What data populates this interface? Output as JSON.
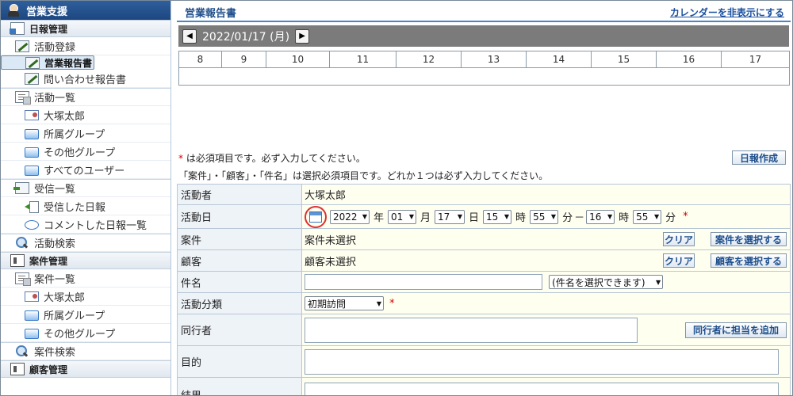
{
  "sidebar": {
    "header": "営業支援",
    "sections": [
      {
        "title": "日報管理",
        "items": [
          {
            "label": "活動登録",
            "icon": "pencil-icon"
          },
          {
            "label": "営業報告書",
            "icon": "pencil-icon",
            "selected": true
          },
          {
            "label": "問い合わせ報告書",
            "icon": "pencil-icon"
          },
          {
            "label": "活動一覧",
            "icon": "list-icon"
          },
          {
            "label": "大塚太郎",
            "icon": "user-card-icon"
          },
          {
            "label": "所属グループ",
            "icon": "folder-icon"
          },
          {
            "label": "その他グループ",
            "icon": "folder-icon"
          },
          {
            "label": "すべてのユーザー",
            "icon": "folder-icon"
          },
          {
            "label": "受信一覧",
            "icon": "inbox-icon"
          },
          {
            "label": "受信した日報",
            "icon": "arrow-in-icon"
          },
          {
            "label": "コメントした日報一覧",
            "icon": "comment-icon"
          },
          {
            "label": "活動検索",
            "icon": "search-icon"
          }
        ]
      },
      {
        "title": "案件管理",
        "items": [
          {
            "label": "案件一覧",
            "icon": "list-icon"
          },
          {
            "label": "大塚太郎",
            "icon": "user-card-icon"
          },
          {
            "label": "所属グループ",
            "icon": "folder-icon"
          },
          {
            "label": "その他グループ",
            "icon": "folder-icon"
          },
          {
            "label": "案件検索",
            "icon": "search-icon"
          }
        ]
      },
      {
        "title": "顧客管理",
        "items": []
      }
    ]
  },
  "main": {
    "title": "営業報告書",
    "hide_calendar_link": "カレンダーを非表示にする",
    "date_display": "2022/01/17 (月)",
    "prev_icon": "◀",
    "next_icon": "▶",
    "hours": [
      "8",
      "9",
      "10",
      "11",
      "12",
      "13",
      "14",
      "15",
      "16",
      "17"
    ],
    "required_note_star": "*",
    "required_note": "は必須項目です。必ず入力してください。",
    "select_note": "「案件」・「顧客」・「件名」は選択必須項目です。どれか１つは必ず入力してください。",
    "create_button": "日報作成"
  },
  "form": {
    "actor": {
      "label": "活動者",
      "value": "大塚太郎"
    },
    "activity_date": {
      "label": "活動日",
      "year": "2022",
      "year_unit": "年",
      "month": "01",
      "month_unit": "月",
      "day": "17",
      "day_unit": "日",
      "start_hour": "15",
      "hour_unit": "時",
      "start_min": "55",
      "min_unit": "分",
      "range_sep": "－",
      "end_hour": "16",
      "end_hour_unit": "時",
      "end_min": "55",
      "end_min_unit": "分",
      "required": "*"
    },
    "case": {
      "label": "案件",
      "value": "案件未選択",
      "clear": "クリア",
      "select": "案件を選択する"
    },
    "customer": {
      "label": "顧客",
      "value": "顧客未選択",
      "clear": "クリア",
      "select": "顧客を選択する"
    },
    "subject": {
      "label": "件名",
      "value": "",
      "select_placeholder": "(件名を選択できます)"
    },
    "category": {
      "label": "活動分類",
      "value": "初期訪問",
      "required": "*"
    },
    "companions": {
      "label": "同行者",
      "value": "",
      "add_button": "同行者に担当を追加"
    },
    "purpose": {
      "label": "目的",
      "value": ""
    },
    "result": {
      "label": "結果",
      "value": ""
    }
  }
}
